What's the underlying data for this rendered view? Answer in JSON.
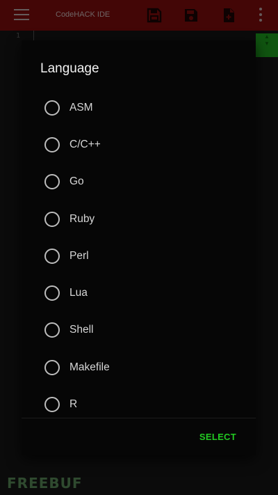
{
  "app": {
    "title": "CodeHACK IDE",
    "bar_color": "#7a0c0c"
  },
  "toolbar": {
    "icons": [
      "menu-icon",
      "save-as-icon",
      "save-icon",
      "new-file-icon",
      "more-vert-icon"
    ]
  },
  "editor": {
    "line_number": "1"
  },
  "dialog": {
    "title": "Language",
    "options": [
      {
        "label": "ASM"
      },
      {
        "label": "C/C++"
      },
      {
        "label": "Go"
      },
      {
        "label": "Ruby"
      },
      {
        "label": "Perl"
      },
      {
        "label": "Lua"
      },
      {
        "label": "Shell"
      },
      {
        "label": "Makefile"
      },
      {
        "label": "R"
      }
    ],
    "select_label": "SELECT",
    "accent_color": "#22c922"
  },
  "watermark": {
    "text": "FREEBUF"
  }
}
